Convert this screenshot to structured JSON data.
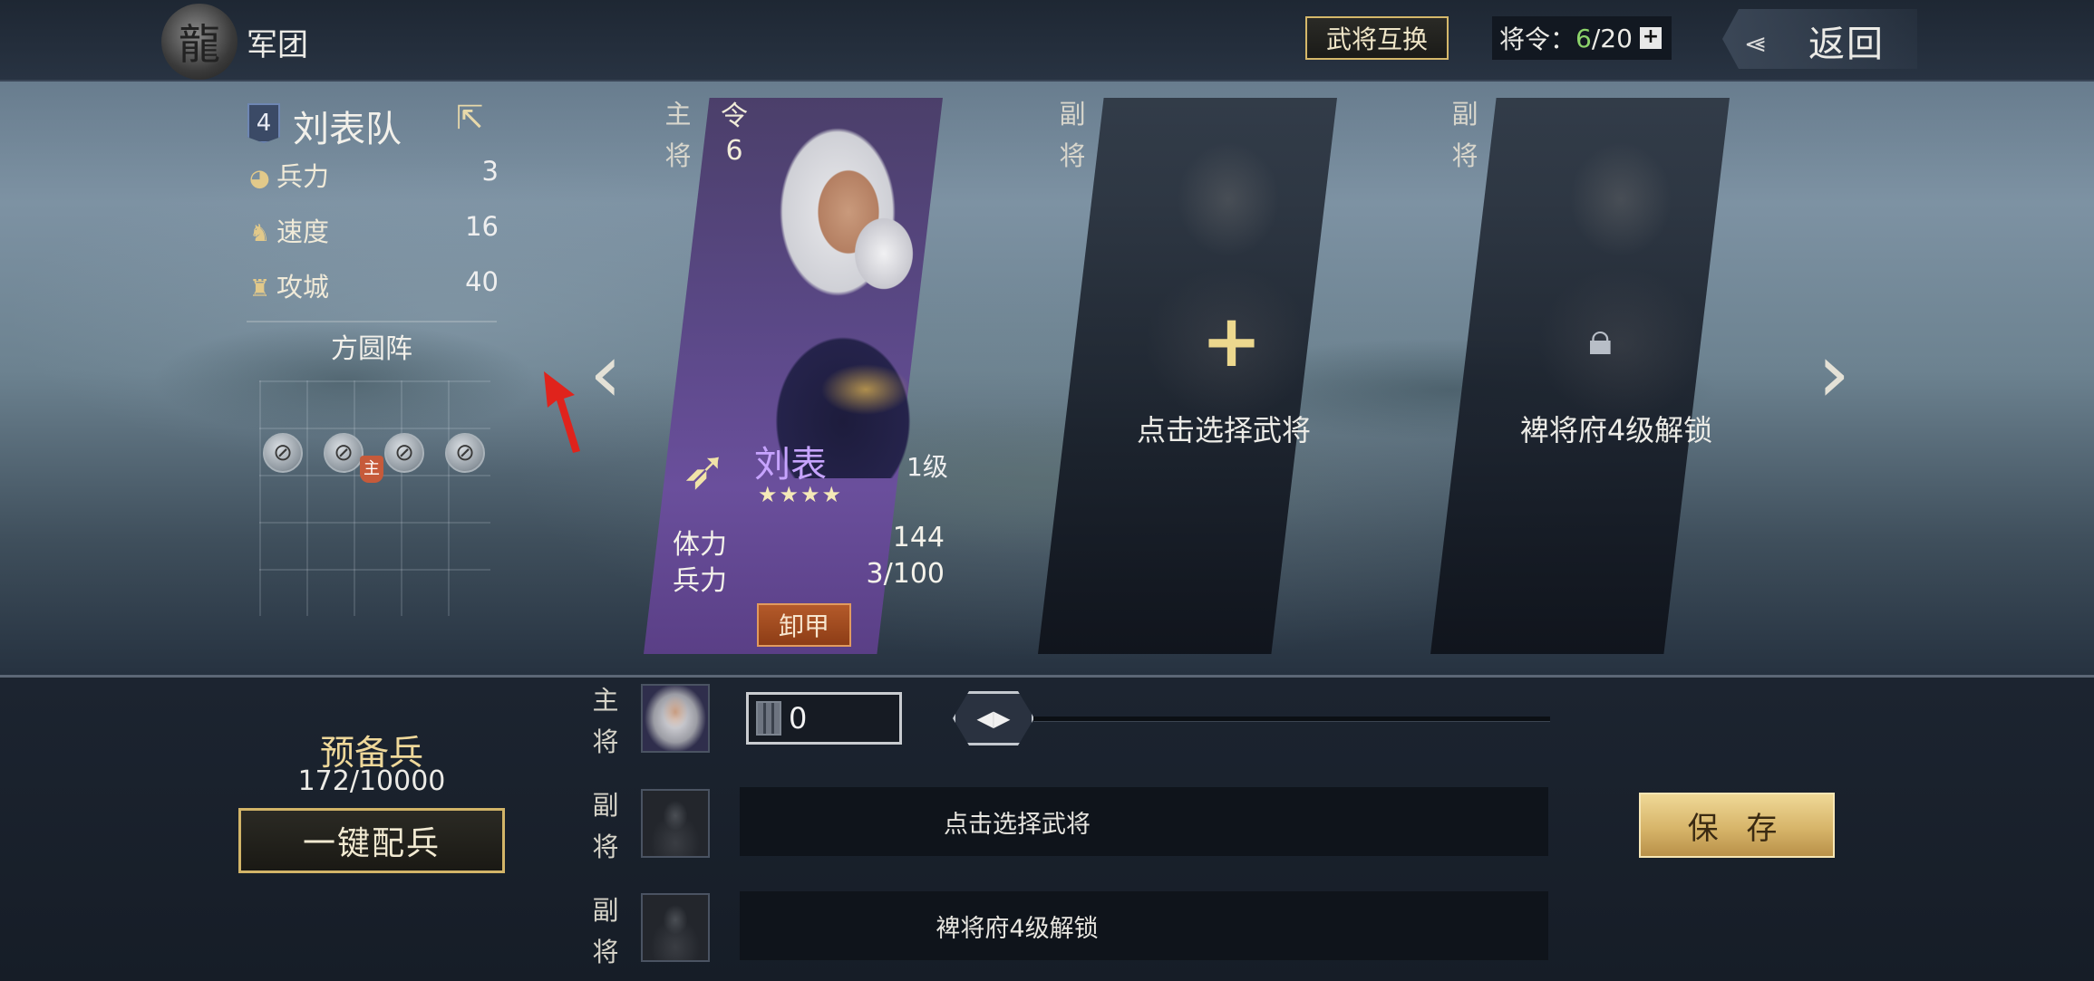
{
  "header": {
    "title": "军团",
    "swap_button": "武将互换",
    "orders_label": "将令：",
    "orders_current": "6",
    "orders_max": "/20",
    "orders_plus": "+",
    "back_label": "返回"
  },
  "team": {
    "number": "4",
    "name": "刘表队",
    "stats": [
      {
        "label": "兵力",
        "value": "3"
      },
      {
        "label": "速度",
        "value": "16"
      },
      {
        "label": "攻城",
        "value": "40"
      }
    ],
    "formation": "方圆阵",
    "commander_marker": "主"
  },
  "slots": {
    "main_label_1": "主",
    "main_label_2": "将",
    "vice_label_1": "副",
    "vice_label_2": "将"
  },
  "main_card": {
    "token": "令",
    "token_count": "6",
    "hero_name": "刘表",
    "level": "1级",
    "stars": "★★★★",
    "stat1_label": "体力",
    "stat1_value": "144",
    "stat2_label": "兵力",
    "stat2_value": "3/100",
    "unequip_button": "卸甲"
  },
  "vice_card_1": {
    "plus": "+",
    "text": "点击选择武将"
  },
  "vice_card_2": {
    "text": "裨将府4级解锁"
  },
  "bottom": {
    "reserve_title": "预备兵",
    "reserve_value": "172/10000",
    "auto_assign_button": "一键配兵",
    "main_troops_value": "0",
    "vice1_text": "点击选择武将",
    "vice2_text": "裨将府4级解锁",
    "save_button": "保 存"
  },
  "colors": {
    "accent_gold": "#d5b86a",
    "hero_name_purple": "#c7a4ff",
    "orders_green": "#8cd36a"
  }
}
